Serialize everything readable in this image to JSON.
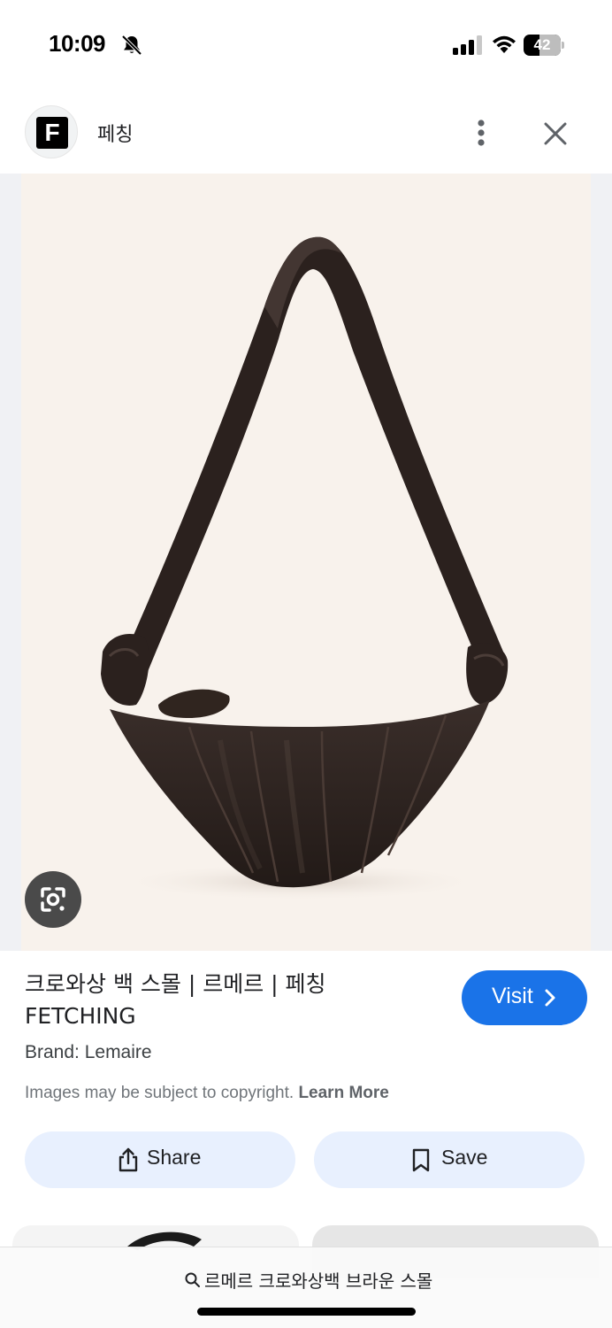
{
  "status_bar": {
    "time": "10:09",
    "battery": "42"
  },
  "header": {
    "logo_letter": "F",
    "site_name": "페칭"
  },
  "result": {
    "title": "크로와상 백 스몰 | 르메르 | 페칭 FETCHING",
    "brand": "Brand: Lemaire",
    "copyright_text": "Images may be subject to copyright.",
    "learn_more": "Learn More",
    "visit_label": "Visit"
  },
  "actions": {
    "share_label": "Share",
    "save_label": "Save"
  },
  "bottom_bar": {
    "query": "르메르 크로와상백 브라운 스몰"
  },
  "colors": {
    "accent": "#1a73e8",
    "action_bg": "#e8f0fe",
    "image_bg": "#f8f2ec",
    "bag": "#2d2320"
  },
  "icons": [
    "bell-muted-icon",
    "signal-icon",
    "wifi-icon",
    "more-vertical-icon",
    "close-icon",
    "google-lens-icon",
    "share-icon",
    "bookmark-icon",
    "search-icon",
    "chevron-right-icon"
  ]
}
